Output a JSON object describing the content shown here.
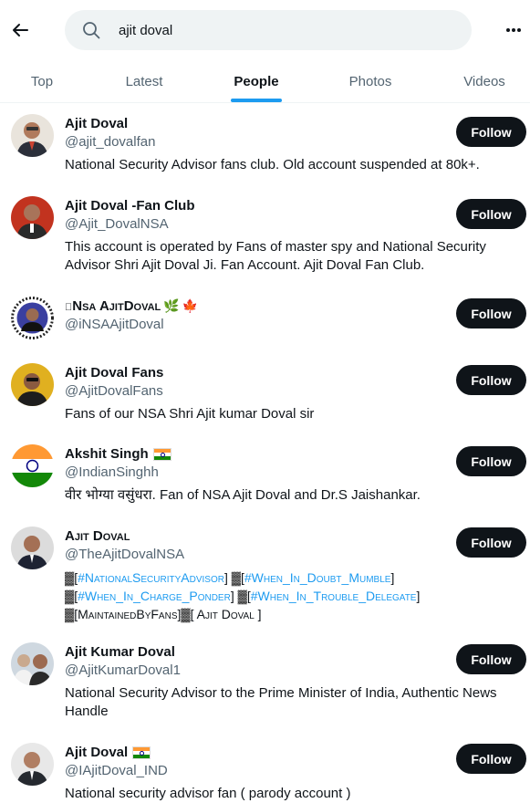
{
  "search": {
    "value": "ajit doval"
  },
  "tabs": [
    {
      "label": "Top"
    },
    {
      "label": "Latest"
    },
    {
      "label": "People"
    },
    {
      "label": "Photos"
    },
    {
      "label": "Videos"
    }
  ],
  "active_tab": "People",
  "icons": {
    "back": "arrow-left-icon",
    "search": "search-icon",
    "more": "more-horizontal-icon"
  },
  "colors": {
    "accent": "#1d9bf0",
    "follow_bg": "#0f1419",
    "muted": "#536471"
  },
  "users": [
    {
      "name": "Ajit Doval",
      "handle": "@ajit_dovalfan",
      "bio": "National Security Advisor fans club. Old account suspended at 80k+.",
      "button": "Follow"
    },
    {
      "name": "Ajit Doval -Fan Club",
      "handle": "@Ajit_DovalNSA",
      "bio": "This account is operated by Fans of master spy and National Security Advisor Shri Ajit Doval Ji. Fan Account. Ajit Doval Fan Club.",
      "button": "Follow"
    },
    {
      "name": "ɪNsa AjitDoval",
      "handle": "@iNSAAjitDoval",
      "bio": "",
      "button": "Follow"
    },
    {
      "name": "Ajit Doval Fans",
      "handle": "@AjitDovalFans",
      "bio": "Fans of our NSA Shri Ajit kumar Doval sir",
      "button": "Follow"
    },
    {
      "name": "Akshit Singh",
      "handle": "@IndianSinghh",
      "bio": "वीर भोग्या वसुंधरा. Fan of NSA Ajit Doval and Dr.S Jaishankar.",
      "button": "Follow"
    },
    {
      "name": "Ajit Doval",
      "handle": "@TheAjitDovalNSA",
      "bio_parts": [
        "[",
        "#NationalSecurityAdvisor",
        "] ",
        "[",
        "#When_In_Doubt_Mumble",
        "]",
        "[",
        "#When_In_Charge_Ponder",
        "] ",
        "[",
        "#When_In_Trouble_Delegate",
        "]",
        "[MaintainedByFans]",
        "[ Ajit Doval ]"
      ],
      "button": "Follow"
    },
    {
      "name": "Ajit Kumar Doval",
      "handle": "@AjitKumarDoval1",
      "bio": "National Security Advisor to the Prime Minister of India, Authentic News Handle",
      "button": "Follow"
    },
    {
      "name": "Ajit Doval",
      "handle": "@IAjitDoval_IND",
      "bio": "National security advisor fan ( parody account )",
      "button": "Follow"
    }
  ]
}
